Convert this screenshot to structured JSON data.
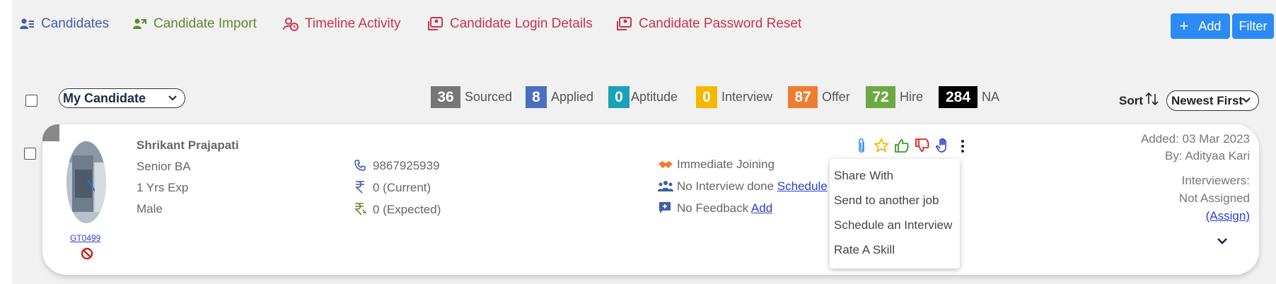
{
  "nav": {
    "items": [
      {
        "label": "Candidates",
        "icon": "candidates-icon"
      },
      {
        "label": "Candidate Import",
        "icon": "import-icon"
      },
      {
        "label": "Timeline Activity",
        "icon": "timeline-icon"
      },
      {
        "label": "Candidate Login Details",
        "icon": "login-details-icon"
      },
      {
        "label": "Candidate Password Reset",
        "icon": "password-reset-icon"
      }
    ],
    "add_label": "Add",
    "filter_label": "Filter"
  },
  "filter_bar": {
    "owner_select": "My Candidate",
    "stats": [
      {
        "count": "36",
        "label": "Sourced",
        "color": "#777777"
      },
      {
        "count": "8",
        "label": "Applied",
        "color": "#4a6fbf"
      },
      {
        "count": "0",
        "label": "Aptitude",
        "color": "#1aa3b8"
      },
      {
        "count": "0",
        "label": "Interview",
        "color": "#f5b800"
      },
      {
        "count": "87",
        "label": "Offer",
        "color": "#ef7d31"
      },
      {
        "count": "72",
        "label": "Hire",
        "color": "#6ea845"
      },
      {
        "count": "284",
        "label": "NA",
        "color": "#000000"
      }
    ],
    "sort_label": "Sort",
    "sort_select": "Newest First"
  },
  "candidate": {
    "name": "Shrikant Prajapati",
    "role": "Senior BA",
    "experience": "1 Yrs Exp",
    "gender": "Male",
    "id": "GT0499",
    "phone": "9867925939",
    "current_ctc": "0 (Current)",
    "expected_ctc": "0 (Expected)",
    "joining": "Immediate Joining",
    "interview_status": "No Interview done",
    "schedule_link": "Schedule",
    "feedback_status": "No Feedback",
    "feedback_link": "Add",
    "added": "Added: 03 Mar 2023",
    "added_by": "By: Adityaa Kari",
    "interviewers_label": "Interviewers:",
    "interviewers_value": "Not Assigned",
    "assign_link": "(Assign)"
  },
  "action_menu": {
    "items": [
      "Share With",
      "Send to another job",
      "Schedule an Interview",
      "Rate A Skill"
    ]
  },
  "colors": {
    "accent": "#2c8af4",
    "nav_blue": "#3f5fa8",
    "nav_green": "#5e8a2e",
    "nav_red": "#c7344f",
    "link": "#2a3fcf"
  }
}
